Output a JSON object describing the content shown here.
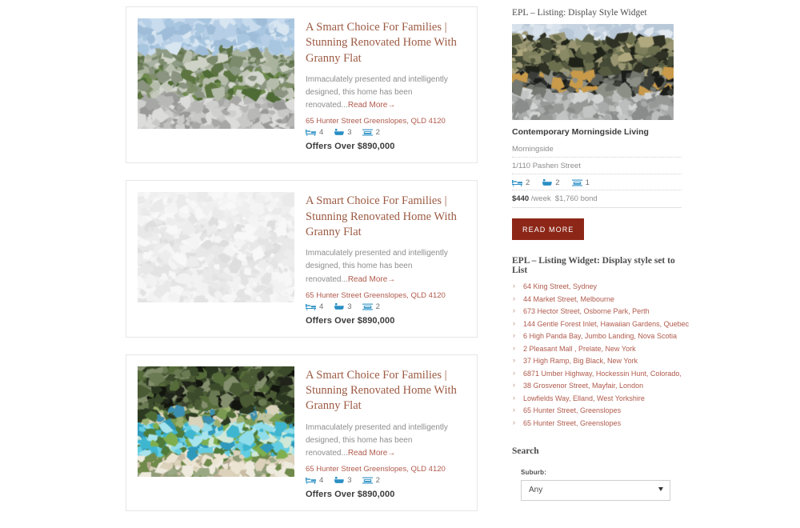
{
  "listings": [
    {
      "title": "A Smart Choice For Families | Stunning Renovated Home With Granny Flat",
      "excerpt": "Immaculately presented and intelligently designed, this home has been renovated...",
      "read_more": "Read More→",
      "address": "65 Hunter Street Greenslopes, QLD 4120",
      "beds": "4",
      "baths": "3",
      "cars": "2",
      "price": "Offers Over $890,000",
      "image_style": "hillside-sky"
    },
    {
      "title": "A Smart Choice For Families | Stunning Renovated Home With Granny Flat",
      "excerpt": "Immaculately presented and intelligently designed, this home has been renovated...",
      "read_more": "Read More→",
      "address": "65 Hunter Street Greenslopes, QLD 4120",
      "beds": "4",
      "baths": "3",
      "cars": "2",
      "price": "Offers Over $890,000",
      "image_style": "pale-gray"
    },
    {
      "title": "A Smart Choice For Families | Stunning Renovated Home With Granny Flat",
      "excerpt": "Immaculately presented and intelligently designed, this home has been renovated...",
      "read_more": "Read More→",
      "address": "65 Hunter Street Greenslopes, QLD 4120",
      "beds": "4",
      "baths": "3",
      "cars": "2",
      "price": "Offers Over $890,000",
      "image_style": "pool-garden"
    }
  ],
  "sidebar": {
    "display_style_widget": {
      "heading": "EPL – Listing: Display Style Widget",
      "property_title": "Contemporary Morningside Living",
      "suburb": "Morningside",
      "street": "1/110 Pashen Street",
      "beds": "2",
      "baths": "2",
      "cars": "1",
      "price_amount": "$440",
      "price_period": "/week",
      "bond": "$1,760 bond",
      "read_more_button": "READ MORE"
    },
    "list_widget": {
      "heading": "EPL – Listing Widget: Display style set to List",
      "items": [
        "64 King Street, Sydney",
        "44 Market Street, Melbourne",
        "673 Hector Street, Osborne Park, Perth",
        "144 Gentle Forest Inlet, Hawaiian Gardens, Quebec",
        "6 High Panda Bay, Jumbo Landing, Nova Scotia",
        "2 Pleasant Mall , Prelate, New York",
        "37 High Ramp, Big Black, New York",
        "6871 Umber Highway, Hockessin Hunt, Colorado,",
        "38 Grosvenor Street, Mayfair, London",
        "Lowfields Way, Elland, West Yorkshire",
        "65 Hunter Street, Greenslopes",
        "65 Hunter Street, Greenslopes"
      ],
      "bullet": "›"
    },
    "search": {
      "heading": "Search",
      "suburb_label": "Suburb:",
      "suburb_value": "Any",
      "suburb_options": [
        "Any"
      ]
    }
  },
  "icons": {
    "bed": "bed-icon",
    "bath": "bath-icon",
    "car": "car-icon"
  },
  "colors": {
    "link": "#b05a4c",
    "title": "#9c5a43",
    "button": "#8c2718",
    "icon_blue": "#2a8fc4",
    "text": "#8d8d8d"
  }
}
